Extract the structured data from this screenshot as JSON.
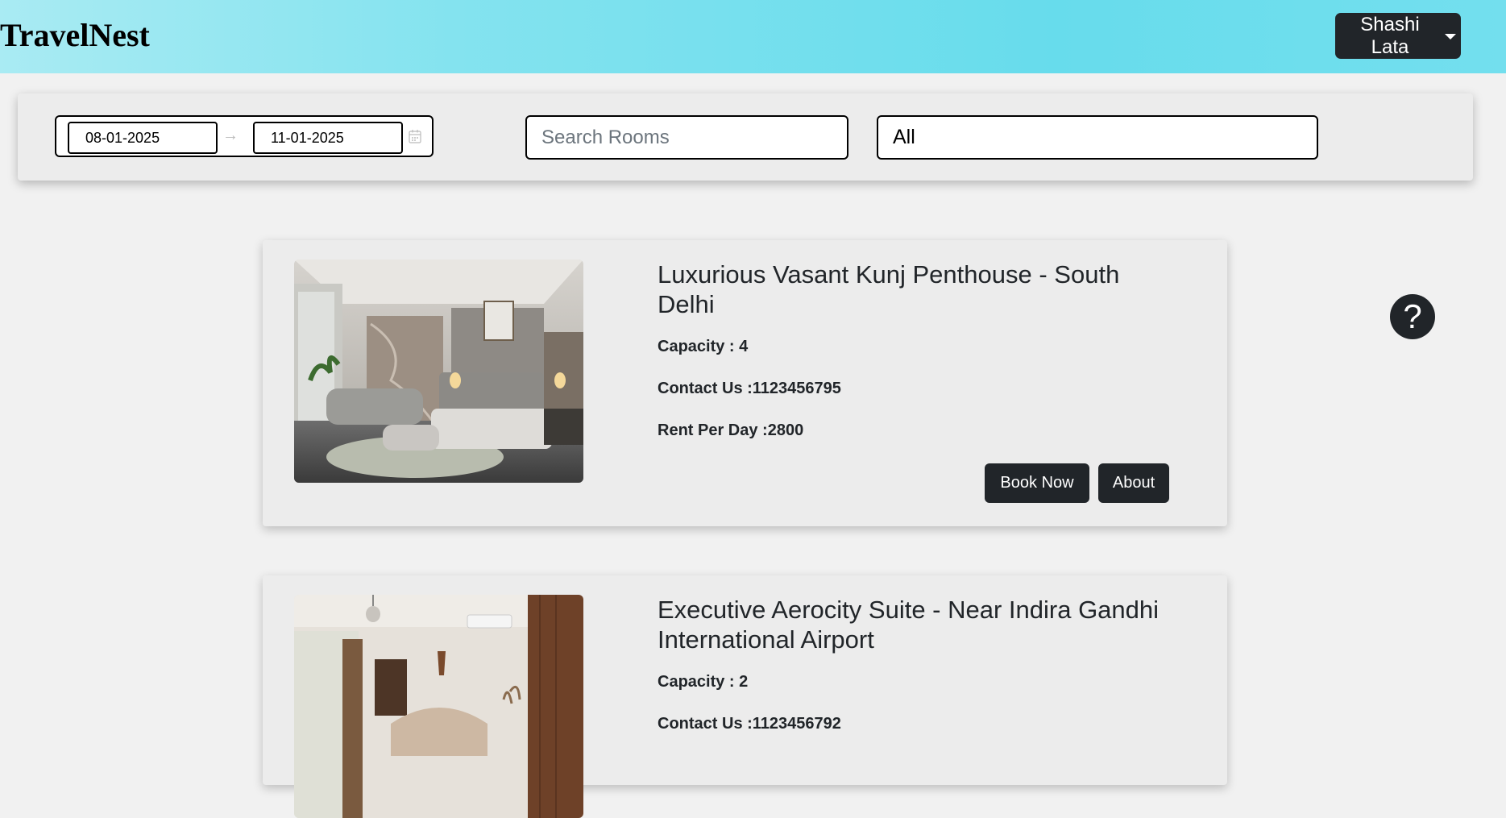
{
  "header": {
    "brand": "TravelNest",
    "user_menu_label": "Shashi Lata"
  },
  "filters": {
    "start_date": "08-01-2025",
    "end_date": "11-01-2025",
    "range_separator": "→",
    "search_placeholder": "Search Rooms",
    "category_selected": "All"
  },
  "rooms": [
    {
      "title": "Luxurious Vasant Kunj Penthouse - South Delhi",
      "capacity": "Capacity : 4",
      "contact": "Contact Us :1123456795",
      "rent": "Rent Per Day :2800",
      "book_label": "Book Now",
      "about_label": "About"
    },
    {
      "title": "Executive Aerocity Suite - Near Indira Gandhi International Airport",
      "capacity": "Capacity : 2",
      "contact": "Contact Us :1123456792"
    }
  ],
  "help": {
    "label": "?"
  },
  "colors": {
    "header_gradient_start": "#a9ebf3",
    "header_gradient_end": "#67dcec",
    "dark_button": "#212529",
    "card_background": "#ececec",
    "page_background": "#f1f1f1"
  }
}
